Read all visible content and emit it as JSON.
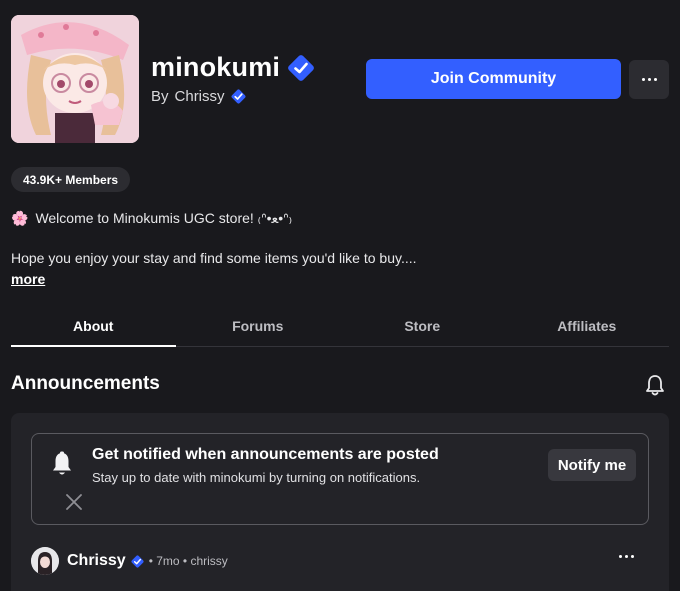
{
  "community": {
    "name": "minokumi",
    "by_prefix": "By",
    "owner": "Chrissy",
    "join_label": "Join Community",
    "members_badge": "43.9K+ Members",
    "welcome_emoji": "🌸",
    "welcome_text": "Welcome to Minokumis UGC store! ₍ᐢ•ﻌ•ᐢ₎",
    "description": "Hope you enjoy your stay and find some items you'd like to buy....",
    "more_label": "more"
  },
  "tabs": [
    {
      "label": "About",
      "active": true
    },
    {
      "label": "Forums",
      "active": false
    },
    {
      "label": "Store",
      "active": false
    },
    {
      "label": "Affiliates",
      "active": false
    }
  ],
  "announcements": {
    "title": "Announcements",
    "notify_card": {
      "heading": "Get notified when announcements are posted",
      "subtext": "Stay up to date with minokumi by turning on notifications.",
      "button": "Notify me"
    },
    "post": {
      "author": "Chrissy",
      "meta": "• 7mo • chrissy"
    }
  },
  "colors": {
    "background": "#19191d",
    "accent": "#335fff",
    "verified": "#335fff"
  }
}
